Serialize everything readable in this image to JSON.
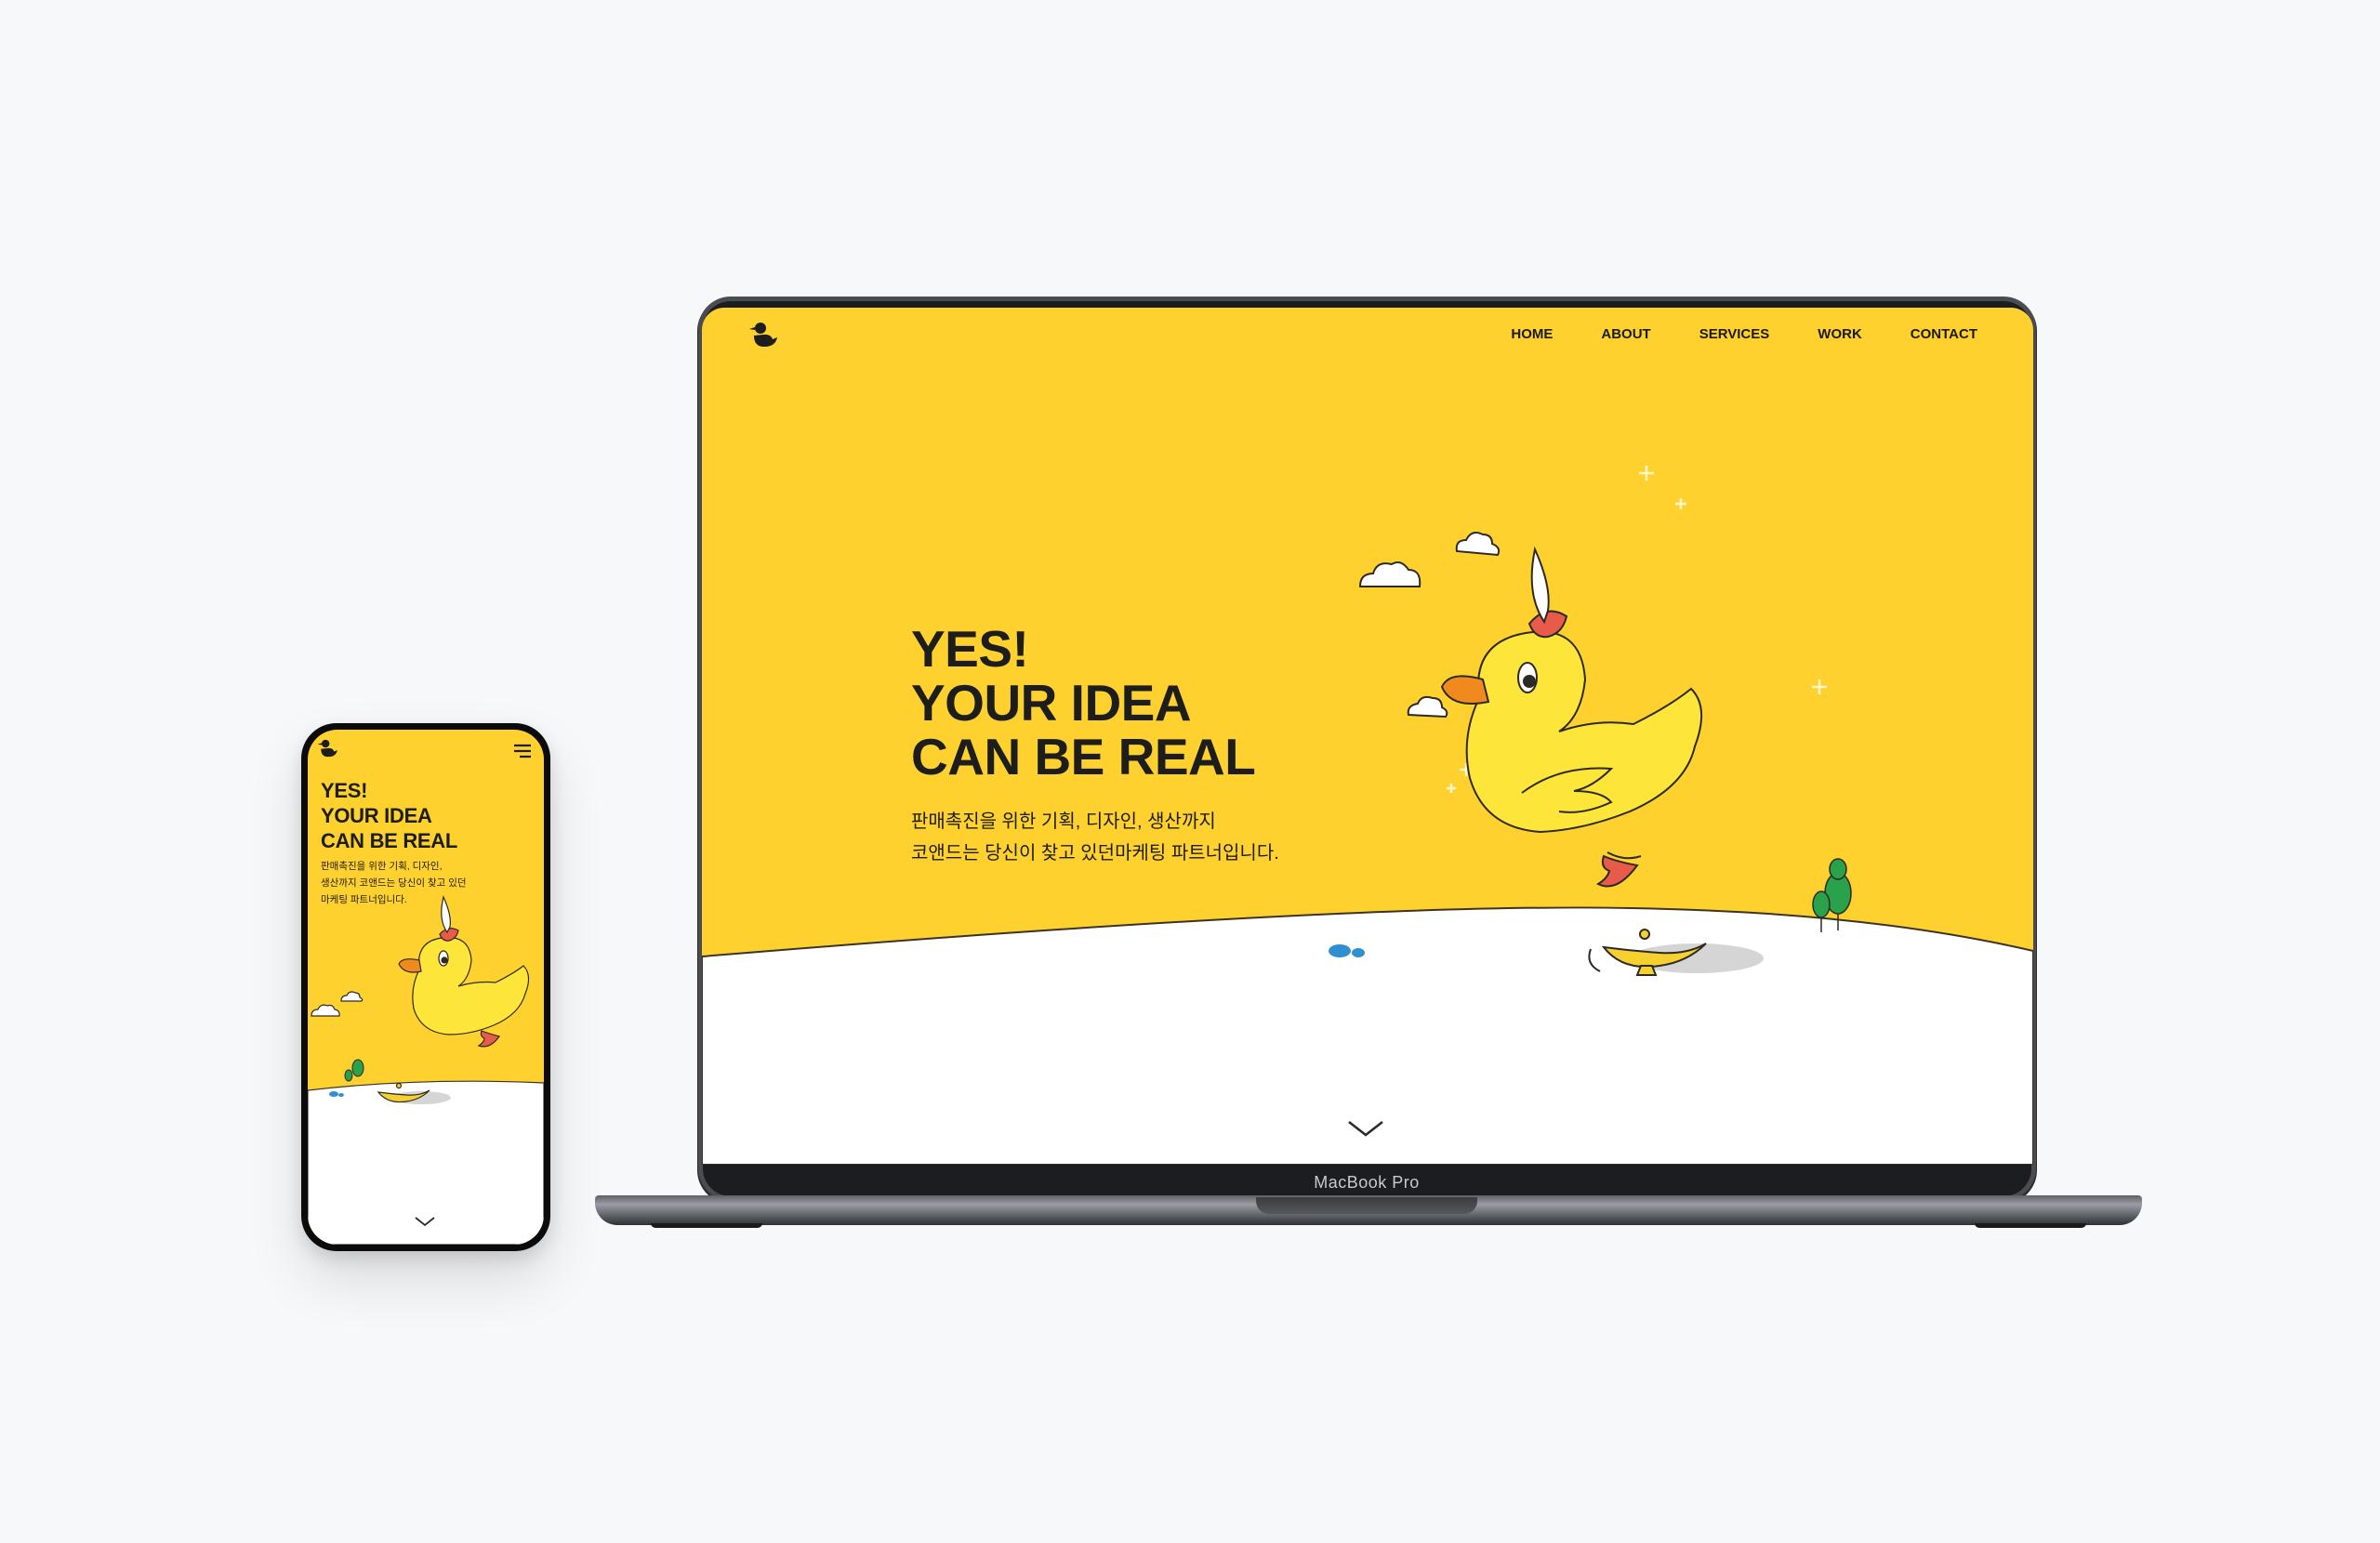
{
  "laptop": {
    "brand_label": "MacBook Pro",
    "nav": [
      {
        "label": "HOME"
      },
      {
        "label": "ABOUT"
      },
      {
        "label": "SERVICES"
      },
      {
        "label": "WORK"
      },
      {
        "label": "CONTACT"
      }
    ],
    "hero": {
      "title_lines": [
        "YES!",
        "YOUR IDEA",
        "CAN BE REAL"
      ],
      "subtitle_lines": [
        "판매촉진을 위한 기획, 디자인, 생산까지",
        "코앤드는 당신이 찾고 있던마케팅 파트너입니다."
      ]
    }
  },
  "phone": {
    "hero": {
      "title_lines": [
        "YES!",
        "YOUR IDEA",
        "CAN BE REAL"
      ],
      "subtitle_lines": [
        "판매촉진을 위한 기획, 디자인,",
        "생산까지 코앤드는 당신이 찾고 있던",
        "마케팅 파트너입니다."
      ]
    }
  },
  "icons": {
    "logo": "duck-logo-icon",
    "menu": "hamburger-menu-icon",
    "scroll": "chevron-down-icon"
  },
  "colors": {
    "brand_yellow": "#fed12f",
    "text": "#1d1d1b",
    "ground": "#ffffff",
    "tree_green": "#2aa14b",
    "stone_blue": "#2f8fd0",
    "beak_orange": "#f08a1f"
  }
}
